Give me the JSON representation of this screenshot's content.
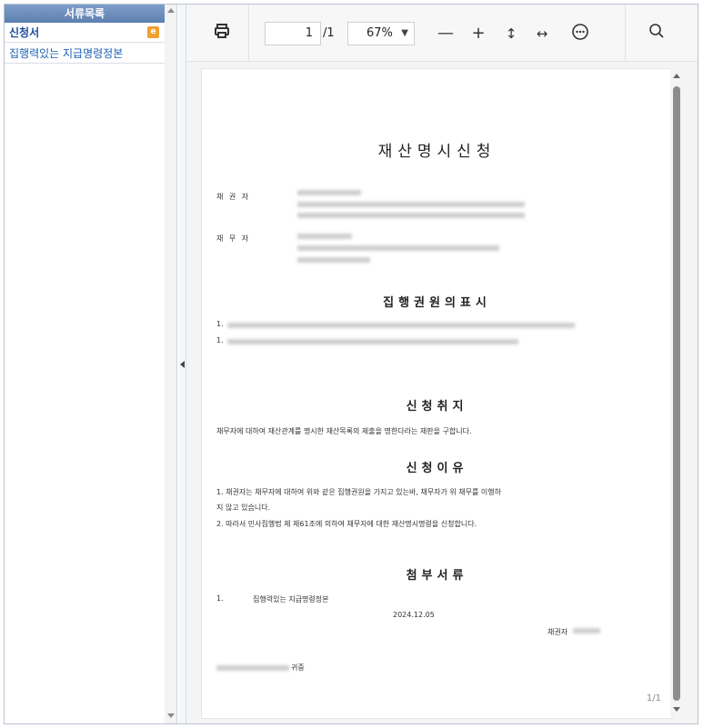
{
  "sidebar": {
    "header": "서류목록",
    "items": [
      {
        "label": "신청서",
        "badge": "e"
      },
      {
        "label": "집행력있는 지급명령정본"
      }
    ]
  },
  "toolbar": {
    "page_current": "1",
    "page_total": "/1",
    "zoom": "67%",
    "icons": [
      "print-icon",
      "zoom-out-icon",
      "zoom-in-icon",
      "fit-height-icon",
      "fit-width-icon",
      "more-icon",
      "search-icon"
    ]
  },
  "document": {
    "title": "재산명시신청",
    "creditor_label": "채 권 자",
    "debtor_label": "채 무 자",
    "title_enforcement": "집행권원의표시",
    "enf_item1": "1.",
    "enf_item2": "1.",
    "title_purpose": "신청취지",
    "purpose_text": "채무자에 대하여 재산관계를 명시한 재산목록의 제출을 명한다라는 재판을 구합니다.",
    "title_reason": "신청이유",
    "reason_line1": "1. 채권자는 채무자에 대하여 위와 같은 집행권원을 가지고 있는바, 채무자가 위 채무를 이행하",
    "reason_line2": "지 않고 있습니다.",
    "reason_line3": "2. 따라서 민사집행법 제 제61조에 의하여 채무자에 대한 재산명시명령을 신청합니다.",
    "title_attachments": "첨부서류",
    "attach1_num": "1.",
    "attach1_text": "집행력있는 지급명령정본",
    "date": "2024.12.05",
    "signer_label": "채권자",
    "court_suffix": "귀중",
    "page_indicator": "1/1"
  }
}
